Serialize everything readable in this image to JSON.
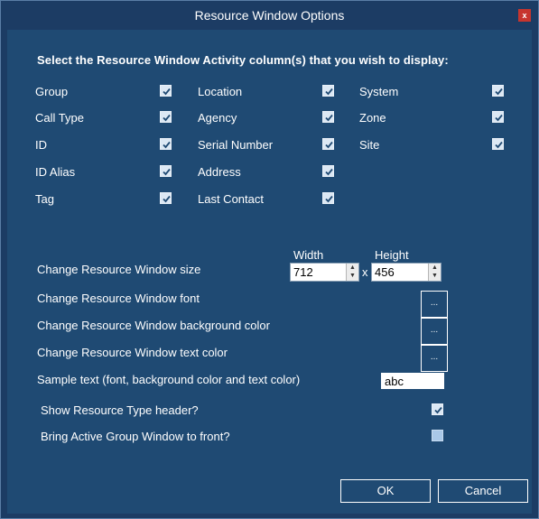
{
  "window": {
    "title": "Resource Window Options",
    "close_glyph": "x"
  },
  "heading": "Select the Resource Window Activity column(s) that you wish to display:",
  "columns": {
    "col1": [
      {
        "label": "Group",
        "checked": true
      },
      {
        "label": "Call Type",
        "checked": true
      },
      {
        "label": "ID",
        "checked": true
      },
      {
        "label": "ID Alias",
        "checked": true
      },
      {
        "label": "Tag",
        "checked": true
      }
    ],
    "col2": [
      {
        "label": "Location",
        "checked": true
      },
      {
        "label": "Agency",
        "checked": true
      },
      {
        "label": "Serial Number",
        "checked": true
      },
      {
        "label": "Address",
        "checked": true
      },
      {
        "label": "Last Contact",
        "checked": true
      }
    ],
    "col3": [
      {
        "label": "System",
        "checked": true
      },
      {
        "label": "Zone",
        "checked": true
      },
      {
        "label": "Site",
        "checked": true
      }
    ]
  },
  "size": {
    "width_label": "Width",
    "height_label": "Height",
    "width_value": "712",
    "height_value": "456",
    "separator": "x",
    "row_label": "Change Resource Window size"
  },
  "font_label": "Change Resource Window font",
  "bg_label": "Change Resource Window background color",
  "text_color_label": "Change Resource Window text color",
  "picker_button_label": "...",
  "sample": {
    "label": "Sample text (font, background color and text color)",
    "text": "abc"
  },
  "options": {
    "show_header": {
      "label": "Show Resource Type header?",
      "checked": true
    },
    "bring_front": {
      "label": "Bring Active Group Window to front?",
      "checked": false
    }
  },
  "buttons": {
    "ok": "OK",
    "cancel": "Cancel"
  },
  "colors": {
    "background": "#1f4a73",
    "titlebar": "#1c3c64",
    "close": "#c7352e"
  }
}
